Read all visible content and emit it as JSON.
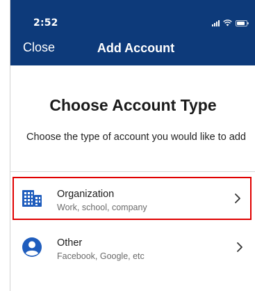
{
  "status_bar": {
    "time": "2:52"
  },
  "nav": {
    "close_label": "Close",
    "title": "Add Account"
  },
  "content": {
    "heading": "Choose Account Type",
    "subtitle": "Choose the type of account you would like to add"
  },
  "options": [
    {
      "title": "Organization",
      "subtitle": "Work, school, company",
      "icon": "building-icon",
      "selected": true
    },
    {
      "title": "Other",
      "subtitle": "Facebook, Google, etc",
      "icon": "person-icon",
      "selected": false
    }
  ],
  "colors": {
    "header": "#0d3a7a",
    "icon_blue": "#1f5dbd",
    "highlight": "#e00000"
  }
}
